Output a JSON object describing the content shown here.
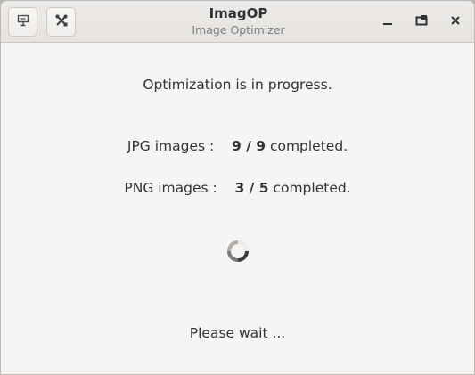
{
  "window": {
    "title": "ImagOP",
    "subtitle": "Image Optimizer"
  },
  "header": {
    "left_buttons": [
      {
        "icon": "download-icon"
      },
      {
        "icon": "tools-icon"
      }
    ],
    "controls": {
      "minimize": "minimize-icon",
      "maximize": "maximize-icon",
      "close": "close-icon"
    }
  },
  "main": {
    "status_text": "Optimization is in progress.",
    "jpg": {
      "label": "JPG images :",
      "progress": "9 / 9",
      "suffix": "completed."
    },
    "png": {
      "label": "PNG images :",
      "progress": "3 / 5",
      "suffix": "completed."
    },
    "footer_text": "Please wait ..."
  }
}
